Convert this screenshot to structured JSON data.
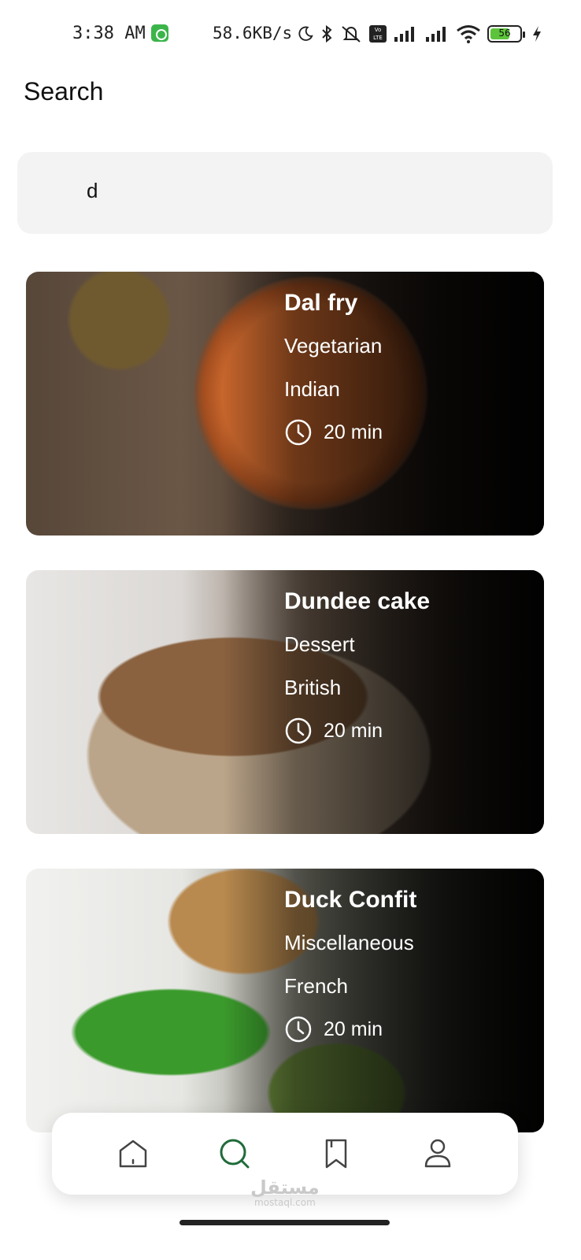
{
  "status_bar": {
    "time": "3:38 AM",
    "network_speed": "58.6KB/s",
    "volte_label": "Vo LTE",
    "battery_level": "56"
  },
  "header": {
    "title": "Search"
  },
  "search": {
    "value": "d"
  },
  "recipes": [
    {
      "title": "Dal fry",
      "category": "Vegetarian",
      "cuisine": "Indian",
      "time": "20 min"
    },
    {
      "title": "Dundee cake",
      "category": "Dessert",
      "cuisine": "British",
      "time": "20 min"
    },
    {
      "title": "Duck Confit",
      "category": "Miscellaneous",
      "cuisine": "French",
      "time": "20 min"
    }
  ],
  "bottom_nav": {
    "items": [
      {
        "icon": "home-icon",
        "active": false
      },
      {
        "icon": "search-icon",
        "active": true
      },
      {
        "icon": "bookmark-icon",
        "active": false
      },
      {
        "icon": "profile-icon",
        "active": false
      }
    ],
    "active_color": "#1f6b3a",
    "inactive_color": "#444444"
  },
  "watermark": {
    "arabic": "مستقل",
    "latin": "mostaql.com"
  }
}
